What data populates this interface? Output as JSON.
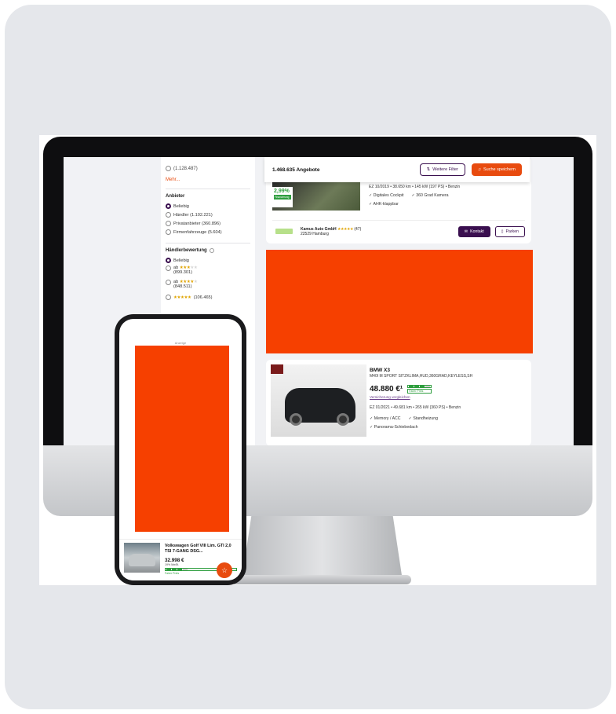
{
  "sidebar": {
    "cut_label": "(1.128.487)",
    "more_link": "Mehr...",
    "anbieter": {
      "title": "Anbieter",
      "options": [
        {
          "label": "Beliebig",
          "selected": true
        },
        {
          "label": "Händler (1.102.221)",
          "selected": false
        },
        {
          "label": "Privatanbieter (360.896)",
          "selected": false
        },
        {
          "label": "Firmenfahrzeuge (5.604)",
          "selected": false
        }
      ]
    },
    "bewertung": {
      "title": "Händlerbewertung",
      "any_label": "Beliebig",
      "options": [
        {
          "prefix": "ab",
          "stars": 3,
          "count": "(899.301)"
        },
        {
          "prefix": "ab",
          "stars": 4,
          "count": "(848.511)"
        },
        {
          "prefix": "",
          "stars": 5,
          "count": "(106.465)"
        }
      ]
    }
  },
  "results": {
    "count": "1.468.635 Angebote",
    "filter_button": "Weitere Filter",
    "save_button": "Suche speichern"
  },
  "listing1": {
    "badge_pct": "2,99%",
    "badge_label": "Finanzierung",
    "specs": "EZ 10/2019 • 38.650 km • 145 kW (197 PS) • Benzin",
    "features": [
      "Digitales Cockpit",
      "360 Grad Kamera",
      "AHK-klappbar"
    ],
    "dealer_name": "Kamus Auto GmbH",
    "dealer_rating_count": "(47)",
    "dealer_city": "22529 Hamburg",
    "contact_button": "Kontakt",
    "park_button": "Parken"
  },
  "listing2": {
    "title": "BMW X3",
    "subtitle": "M40I M SPORT SITZKLIMA,HUD,360GRAD,KEYLESS,SH",
    "price": "48.880 €¹",
    "price_rating": "Fairer Preis",
    "insurance_link": "Versicherung vergleichen",
    "specs": "EZ 01/2021 • 49.681 km • 265 kW (360 PS) • Benzin",
    "features": [
      "Memory / ACC",
      "Standheizung",
      "Panorama-Schiebedach"
    ]
  },
  "phone": {
    "ad_label": "Anzeige",
    "car_title": "Volkswagen Golf VIII Lim. GTI 2,0 TSI 7-GANG DSG...",
    "price": "32.998 €",
    "vat": "19% MwSt.",
    "price_rating": "Fairer Preis",
    "fab_icon": "star-icon"
  },
  "colors": {
    "accent": "#e84b0f",
    "ad": "#f64000",
    "brand_dark": "#3a0f4f",
    "good": "#2e9e3e"
  }
}
